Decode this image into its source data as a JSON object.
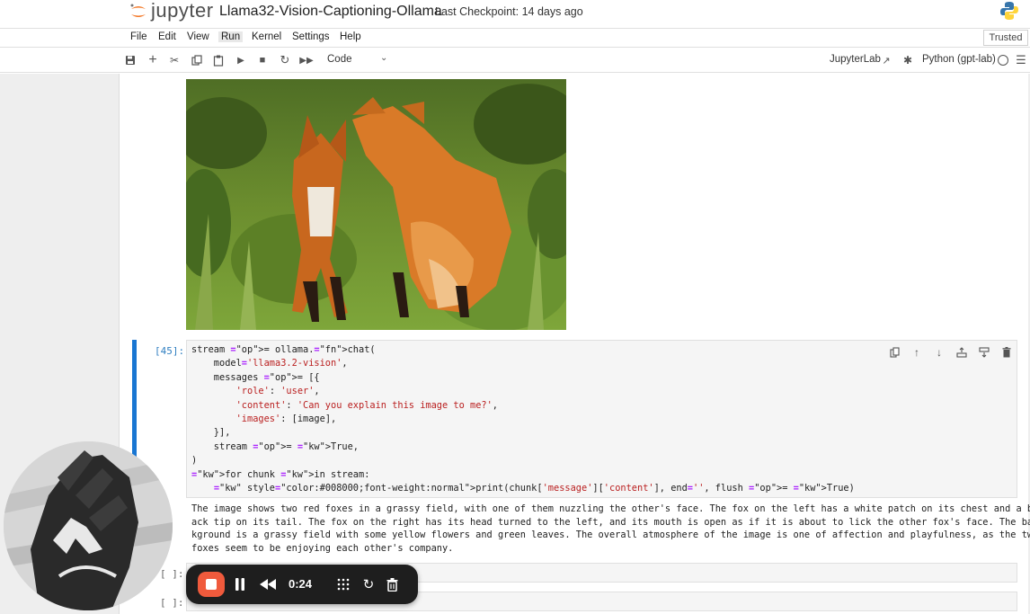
{
  "header": {
    "logo_text": "jupyter",
    "notebook_title": "Llama32-Vision-Captioning-Ollama",
    "checkpoint": "Last Checkpoint: 14 days ago"
  },
  "menu": {
    "items": [
      "File",
      "Edit",
      "View",
      "Run",
      "Kernel",
      "Settings",
      "Help"
    ],
    "active": "Run",
    "trusted": "Trusted"
  },
  "toolbar": {
    "buttons": [
      "save-icon",
      "add-cell-icon",
      "cut-icon",
      "copy-icon",
      "paste-icon",
      "run-icon",
      "stop-icon",
      "restart-icon",
      "fast-forward-icon"
    ],
    "cell_type": "Code",
    "jupyterlab_link": "JupyterLab",
    "kernel": "Python (gpt-lab)"
  },
  "cell": {
    "prompt": "[45]:",
    "code_lines": [
      "stream = ollama.chat(",
      "    model='llama3.2-vision',",
      "    messages = [{",
      "        'role': 'user',",
      "        'content': 'Can you explain this image to me?',",
      "        'images': [image],",
      "    }],",
      "    stream = True,",
      ")",
      "for chunk in stream:",
      "    print(chunk['message']['content'], end='', flush = True)"
    ],
    "cell_tools": [
      "duplicate-icon",
      "move-up-icon",
      "move-down-icon",
      "insert-above-icon",
      "insert-below-icon",
      "delete-icon"
    ],
    "output_lines": [
      "The image shows two red foxes in a grassy field, with one of them nuzzling the other's face. The fox on the left has a white patch on its chest and a bl",
      "ack tip on its tail. The fox on the right has its head turned to the left, and its mouth is open as if it is about to lick the other fox's face. The bac",
      "kground is a grassy field with some yellow flowers and green leaves. The overall atmosphere of the image is one of affection and playfulness, as the two",
      "foxes seem to be enjoying each other's company."
    ]
  },
  "empty_cells": [
    "[ ]:",
    "[ ]:"
  ],
  "recorder": {
    "time": "0:24"
  },
  "colors": {
    "active_cell_bar": "#1976d2",
    "prompt_blue": "#307fc1",
    "record_button": "#f05a3c"
  }
}
